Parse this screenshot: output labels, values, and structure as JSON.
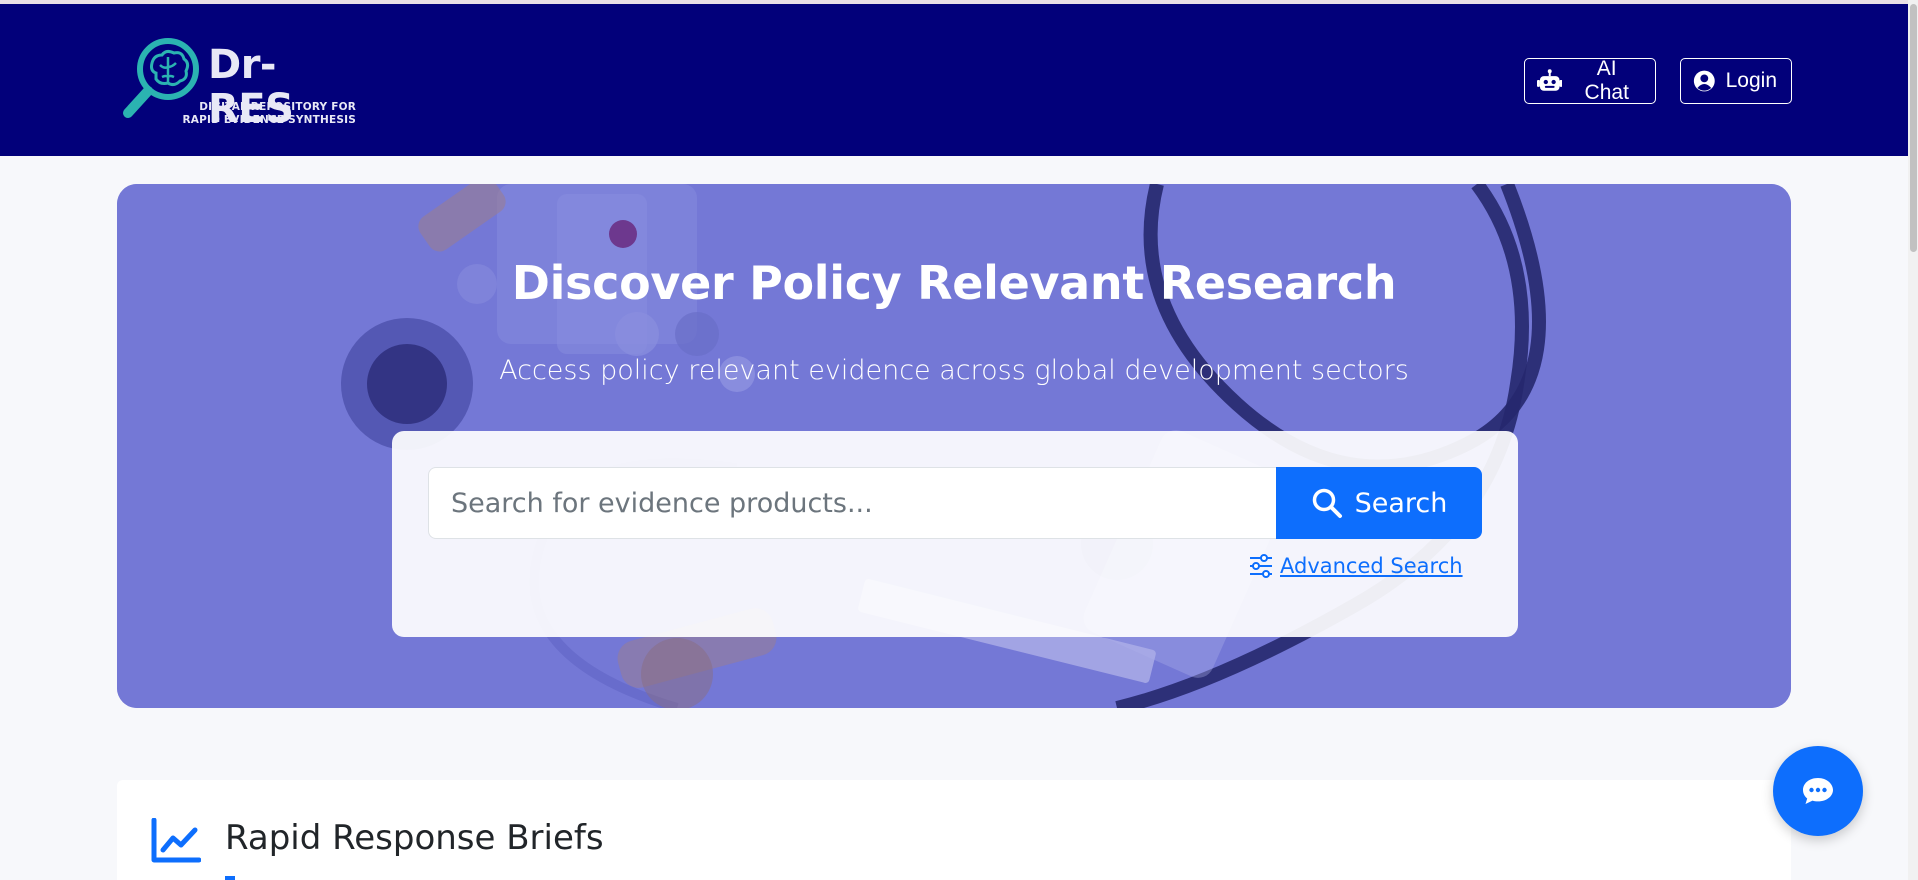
{
  "brand": {
    "name": "Dr-RES",
    "tagline_line1": "DIGITAL REPOSITORY FOR",
    "tagline_line2": "RAPID EVIDENCE SYNTHESIS"
  },
  "header": {
    "ai_chat_label": "AI Chat",
    "login_label": "Login"
  },
  "hero": {
    "title": "Discover Policy Relevant Research",
    "subtitle": "Access policy relevant evidence across global development sectors"
  },
  "search": {
    "placeholder": "Search for evidence products...",
    "button_label": "Search",
    "advanced_label": "Advanced Search"
  },
  "section": {
    "title": "Rapid Response Briefs"
  },
  "icons": {
    "logo": "brain-magnifier-icon",
    "ai_chat": "robot-icon",
    "login": "user-circle-icon",
    "search": "search-icon",
    "advanced": "sliders-icon",
    "section": "chart-line-icon",
    "fab": "chat-bubble-icon"
  },
  "colors": {
    "header_bg": "#02007a",
    "hero_overlay": "#7276d4",
    "primary": "#0d6efd",
    "page_bg": "#f7f8fb",
    "logo_teal": "#2bb3b1"
  }
}
